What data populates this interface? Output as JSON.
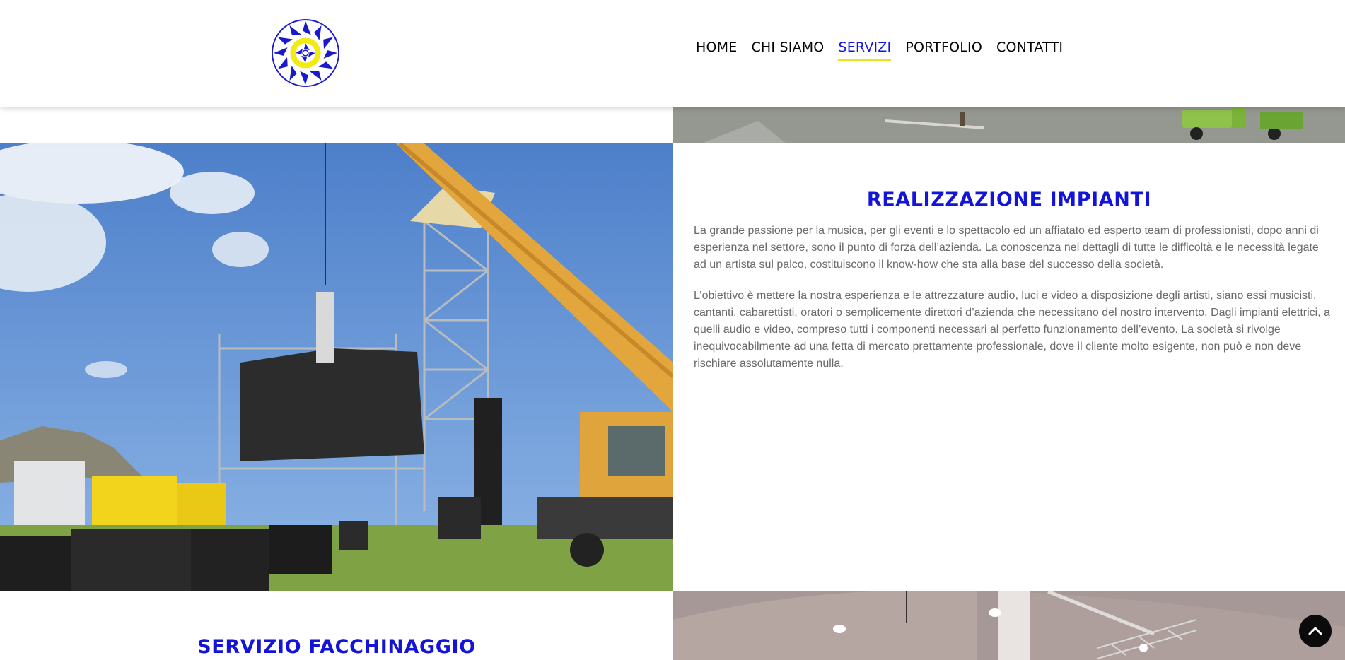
{
  "header": {
    "logo_icon": "sun-spiral-logo-icon",
    "nav": [
      {
        "label": "HOME",
        "active": false
      },
      {
        "label": "CHI SIAMO",
        "active": false
      },
      {
        "label": "SERVIZI",
        "active": true
      },
      {
        "label": "PORTFOLIO",
        "active": false
      },
      {
        "label": "CONTATTI",
        "active": false
      }
    ]
  },
  "section_impianti": {
    "title": "REALIZZAZIONE IMPIANTI",
    "paragraphs": [
      "La grande passione per la musica, per gli eventi e lo spettacolo ed un affiatato ed esperto team di professionisti, dopo anni di esperienza nel settore, sono il punto di forza dell’azienda. La conoscenza nei dettagli di tutte le difficoltà e le necessità legate ad un artista sul palco, costituiscono il know-how che sta alla base del successo della società.",
      "L’obiettivo è mettere la nostra esperienza e le attrezzature audio, luci e video a disposizione degli artisti, siano essi musicisti, cantanti, cabarettisti, oratori o semplicemente direttori d’azienda che necessitano del nostro intervento. Dagli impianti elettrici, a quelli audio e video, compreso tutti i componenti necessari al perfetto funzionamento dell’evento. La società si rivolge inequivocabilmente ad una fetta di mercato prettamente professionale, dove il cliente molto esigente, non può e non deve rischiare assolutamente nulla."
    ]
  },
  "section_facchinaggio": {
    "title": "SERVIZIO FACCHINAGGIO"
  },
  "scroll_top": {
    "icon": "chevron-up-icon"
  },
  "colors": {
    "accent": "#1414d8",
    "underline": "#f0e020",
    "text": "#6a6a6a"
  }
}
